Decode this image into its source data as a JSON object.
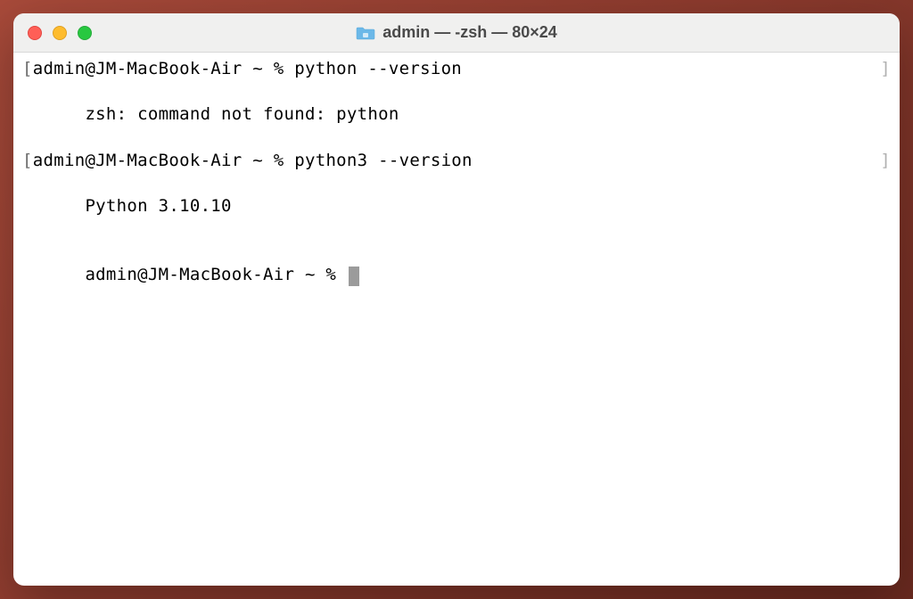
{
  "window": {
    "title": "admin — -zsh — 80×24"
  },
  "terminal": {
    "lines": [
      {
        "bracket_left": "[",
        "content": "admin@JM-MacBook-Air ~ % python --version",
        "bracket_right": "]"
      },
      {
        "content": "zsh: command not found: python"
      },
      {
        "bracket_left": "[",
        "content": "admin@JM-MacBook-Air ~ % python3 --version",
        "bracket_right": "]"
      },
      {
        "content": "Python 3.10.10"
      },
      {
        "prompt": "admin@JM-MacBook-Air ~ % ",
        "cursor": true
      }
    ]
  }
}
